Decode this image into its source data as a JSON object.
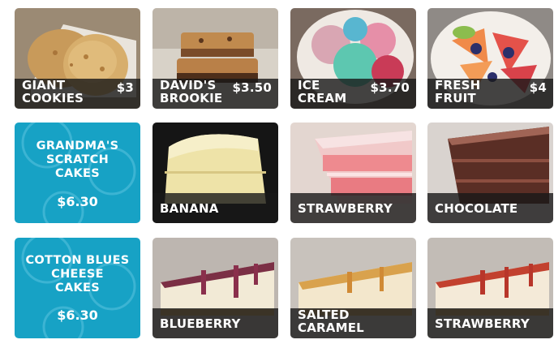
{
  "menu": {
    "row1": [
      {
        "name": "GIANT\nCOOKIES",
        "price": "$3"
      },
      {
        "name": "DAVID'S\nBROOKIE",
        "price": "$3.50"
      },
      {
        "name": "ICE\nCREAM",
        "price": "$3.70"
      },
      {
        "name": "FRESH\nFRUIT",
        "price": "$4"
      }
    ],
    "scratch_cakes": {
      "title": "GRANDMA'S\nSCRATCH\nCAKES",
      "price": "$6.30",
      "flavors": [
        "BANANA",
        "STRAWBERRY",
        "CHOCOLATE"
      ]
    },
    "cheese_cakes": {
      "title": "COTTON BLUES\nCHEESE\nCAKES",
      "price": "$6.30",
      "flavors": [
        "BLUEBERRY",
        "SALTED\nCARAMEL",
        "STRAWBERRY"
      ]
    }
  },
  "colors": {
    "accent_blue": "#17a2c5",
    "caption_bg": "#181818"
  }
}
